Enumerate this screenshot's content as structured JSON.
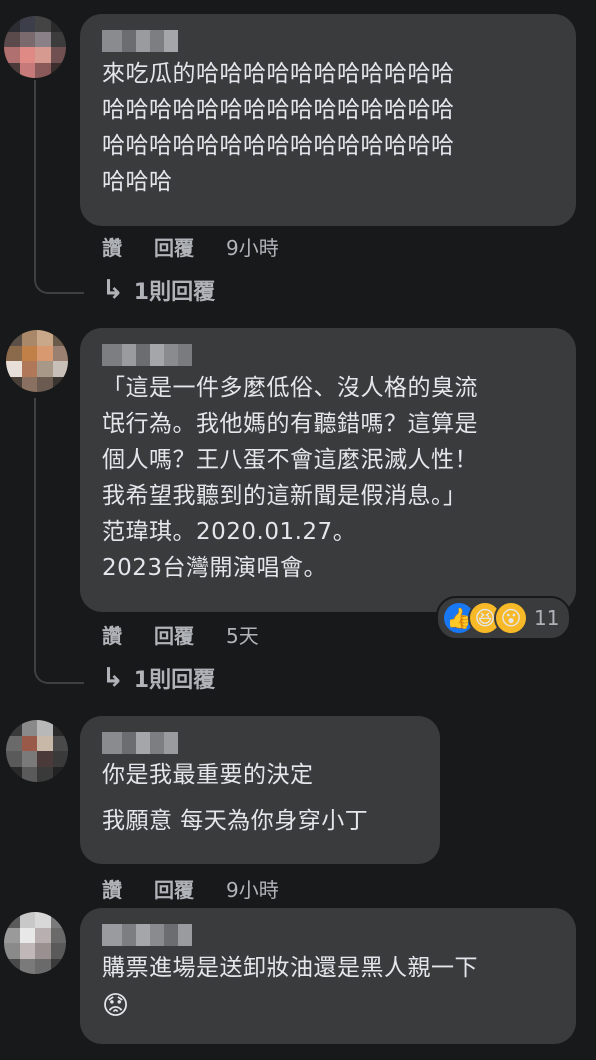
{
  "comments": [
    {
      "text": "來吃瓜的哈哈哈哈哈哈哈哈哈哈哈\n哈哈哈哈哈哈哈哈哈哈哈哈哈哈哈\n哈哈哈哈哈哈哈哈哈哈哈哈哈哈哈\n哈哈哈",
      "actions": {
        "like": "讚",
        "reply": "回覆",
        "time": "9小時"
      },
      "replies_label": "1則回覆"
    },
    {
      "text": "「這是一件多麼低俗、沒人格的臭流\n氓行為。我他媽的有聽錯嗎？這算是\n個人嗎？王八蛋不會這麼泯滅人性！\n我希望我聽到的這新聞是假消息。」\n范瑋琪。2020.01.27。\n2023台灣開演唱會。",
      "actions": {
        "like": "讚",
        "reply": "回覆",
        "time": "5天"
      },
      "reaction_count": "11",
      "replies_label": "1則回覆"
    },
    {
      "text": "你是我最重要的決定\n我願意 每天為你身穿小丁",
      "actions": {
        "like": "讚",
        "reply": "回覆",
        "time": "9小時"
      }
    },
    {
      "text": "購票進場是送卸妝油還是黑人親一下",
      "actions": {}
    }
  ],
  "icons": {
    "reply_arrow": "reply-arrow-icon",
    "like_reaction": "like-reaction-icon",
    "haha_reaction": "haha-reaction-icon",
    "wow_reaction": "wow-reaction-icon",
    "worried_emoji": "worried-emoji-icon"
  },
  "colors": {
    "background": "#18191a",
    "bubble": "#3a3b3c",
    "text": "#e4e6eb",
    "secondary_text": "#b0b3b8",
    "like_blue": "#1877f2",
    "emoji_yellow": "#f7b928"
  }
}
